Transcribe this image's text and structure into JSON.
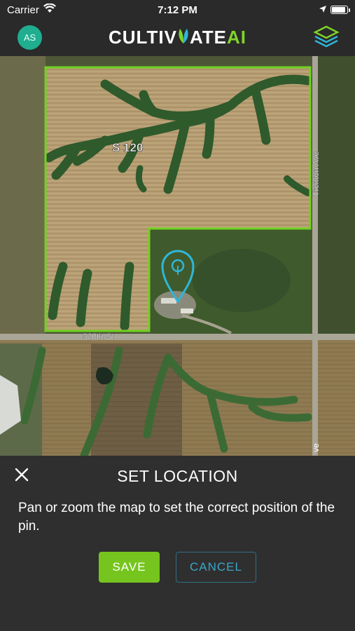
{
  "status_bar": {
    "carrier": "Carrier",
    "time": "7:12 PM",
    "battery_level": 0.92
  },
  "header": {
    "avatar_initials": "AS",
    "logo_prefix": "CULTIV",
    "logo_mid": "ATE",
    "logo_suffix": "AI",
    "menu_icon": "layers-icon"
  },
  "map": {
    "field_label": "S 120",
    "road_horizontal": "320th St",
    "road_vertical": "Trenton Ave",
    "road_vertical_fragment": "ve",
    "field_outline_color": "#6fd21f",
    "pin_color": "#2fb6d9"
  },
  "panel": {
    "title": "SET LOCATION",
    "message": "Pan or zoom the map to set the correct position of the pin.",
    "save_label": "SAVE",
    "cancel_label": "CANCEL"
  },
  "colors": {
    "accent": "#76c51e",
    "cancel": "#3aa6c9",
    "avatar": "#1fae8f"
  }
}
